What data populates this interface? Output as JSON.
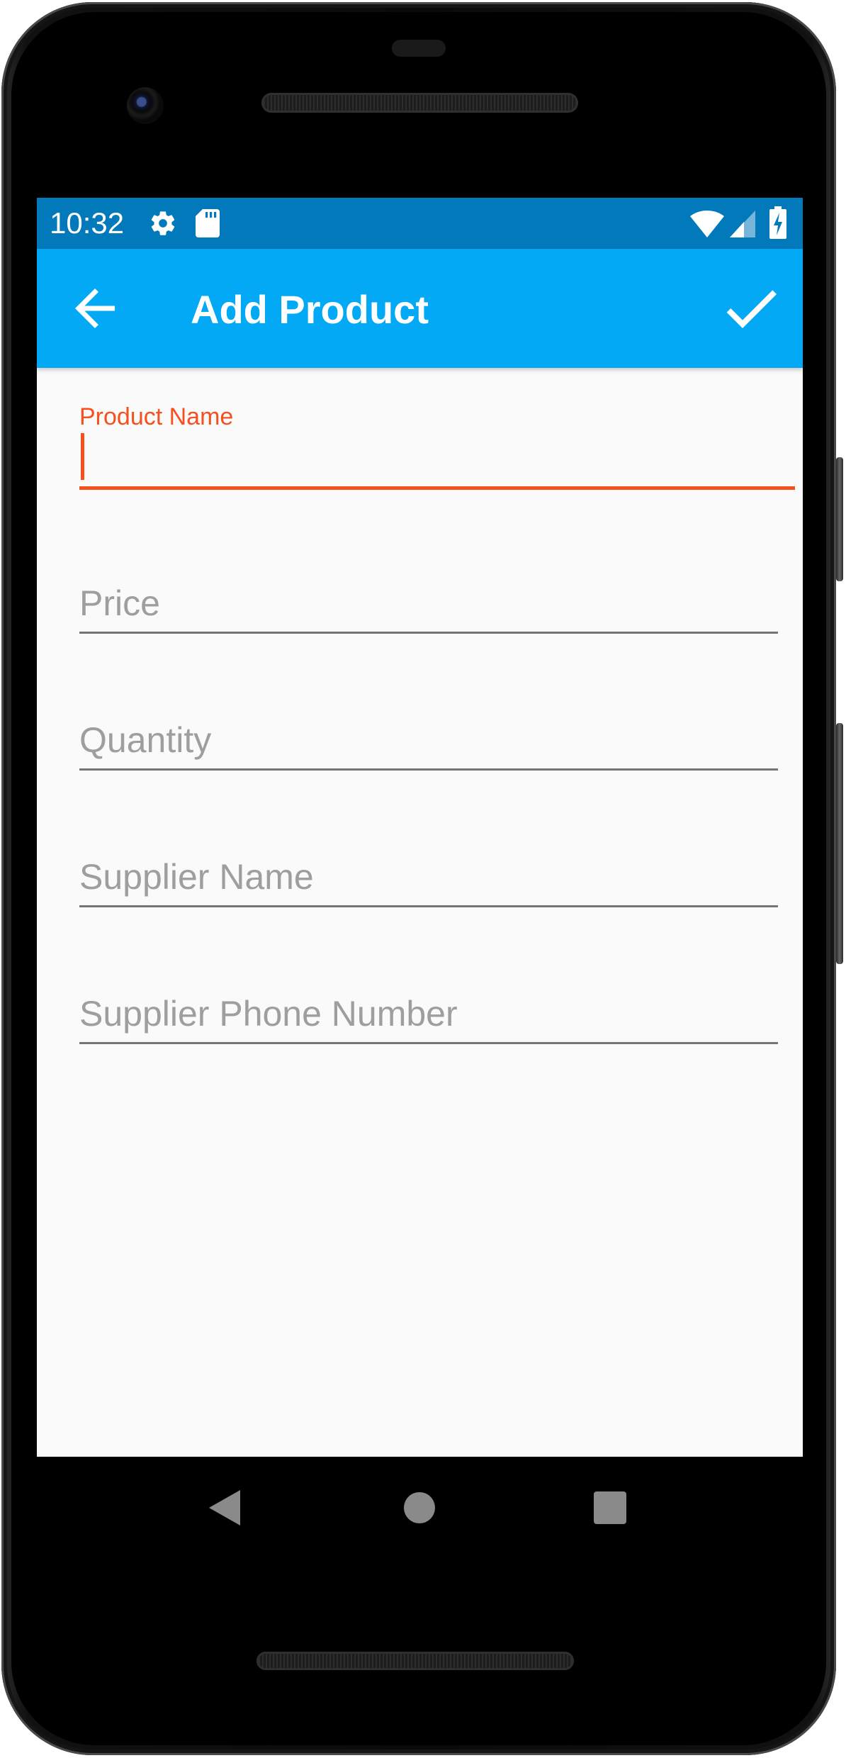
{
  "status_bar": {
    "time": "10:32",
    "icons": [
      "gear-icon",
      "sd-card-icon",
      "wifi-icon",
      "signal-icon",
      "battery-charging-icon"
    ]
  },
  "app_bar": {
    "title": "Add Product",
    "back_icon": "arrow-back-icon",
    "save_icon": "check-icon",
    "background": "#03a9f4",
    "status_background": "#0279bb"
  },
  "form": {
    "product_name": {
      "label": "Product Name",
      "value": "",
      "focused": true
    },
    "price": {
      "placeholder": "Price",
      "value": ""
    },
    "quantity": {
      "placeholder": "Quantity",
      "value": ""
    },
    "supplier_name": {
      "placeholder": "Supplier Name",
      "value": ""
    },
    "supplier_phone": {
      "placeholder": "Supplier Phone Number",
      "value": ""
    },
    "accent_color": "#f4511e"
  },
  "nav_bar": {
    "back": "nav-back-icon",
    "home": "nav-home-icon",
    "recents": "nav-recents-icon"
  }
}
